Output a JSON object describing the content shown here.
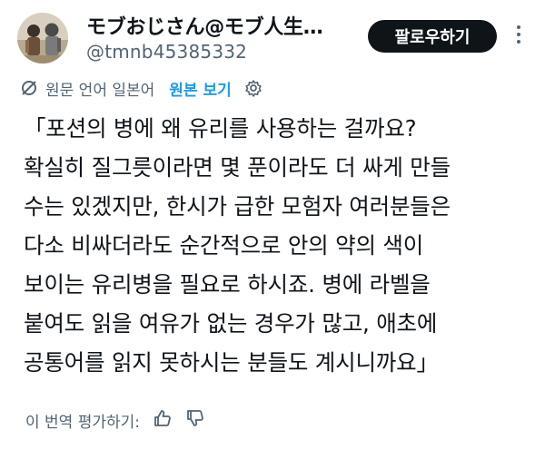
{
  "user": {
    "display_name": "モブおじさん@モブ人生…",
    "handle": "@tmnb45385332",
    "avatar_icon": "avatar-photo"
  },
  "header": {
    "follow_label": "팔로우하기",
    "more_icon": "more-vertical-icon"
  },
  "translation": {
    "icon": "translate-slash-icon",
    "label": "원문 언어 일본어",
    "show_original": "원본 보기",
    "settings_icon": "gear-icon"
  },
  "tweet": {
    "lines": [
      "「포션의 병에 왜 유리를 사용하는 걸까요?",
      "확실히 질그릇이라면 몇 푼이라도 더 싸게 만들",
      "수는 있겠지만, 한시가 급한 모험자 여러분들은",
      "다소 비싸더라도 순간적으로 안의 약의 색이",
      "보이는 유리병을 필요로 하시죠. 병에 라벨을",
      "붙여도 읽을 여유가 없는 경우가 많고, 애초에",
      "공통어를 읽지 못하시는 분들도 계시니까요」"
    ]
  },
  "rating": {
    "label": "이 번역 평가하기:",
    "thumbs_up_icon": "thumbs-up-icon",
    "thumbs_down_icon": "thumbs-down-icon"
  },
  "colors": {
    "accent": "#1d9bf0",
    "muted": "#536471",
    "text": "#0f1419"
  }
}
